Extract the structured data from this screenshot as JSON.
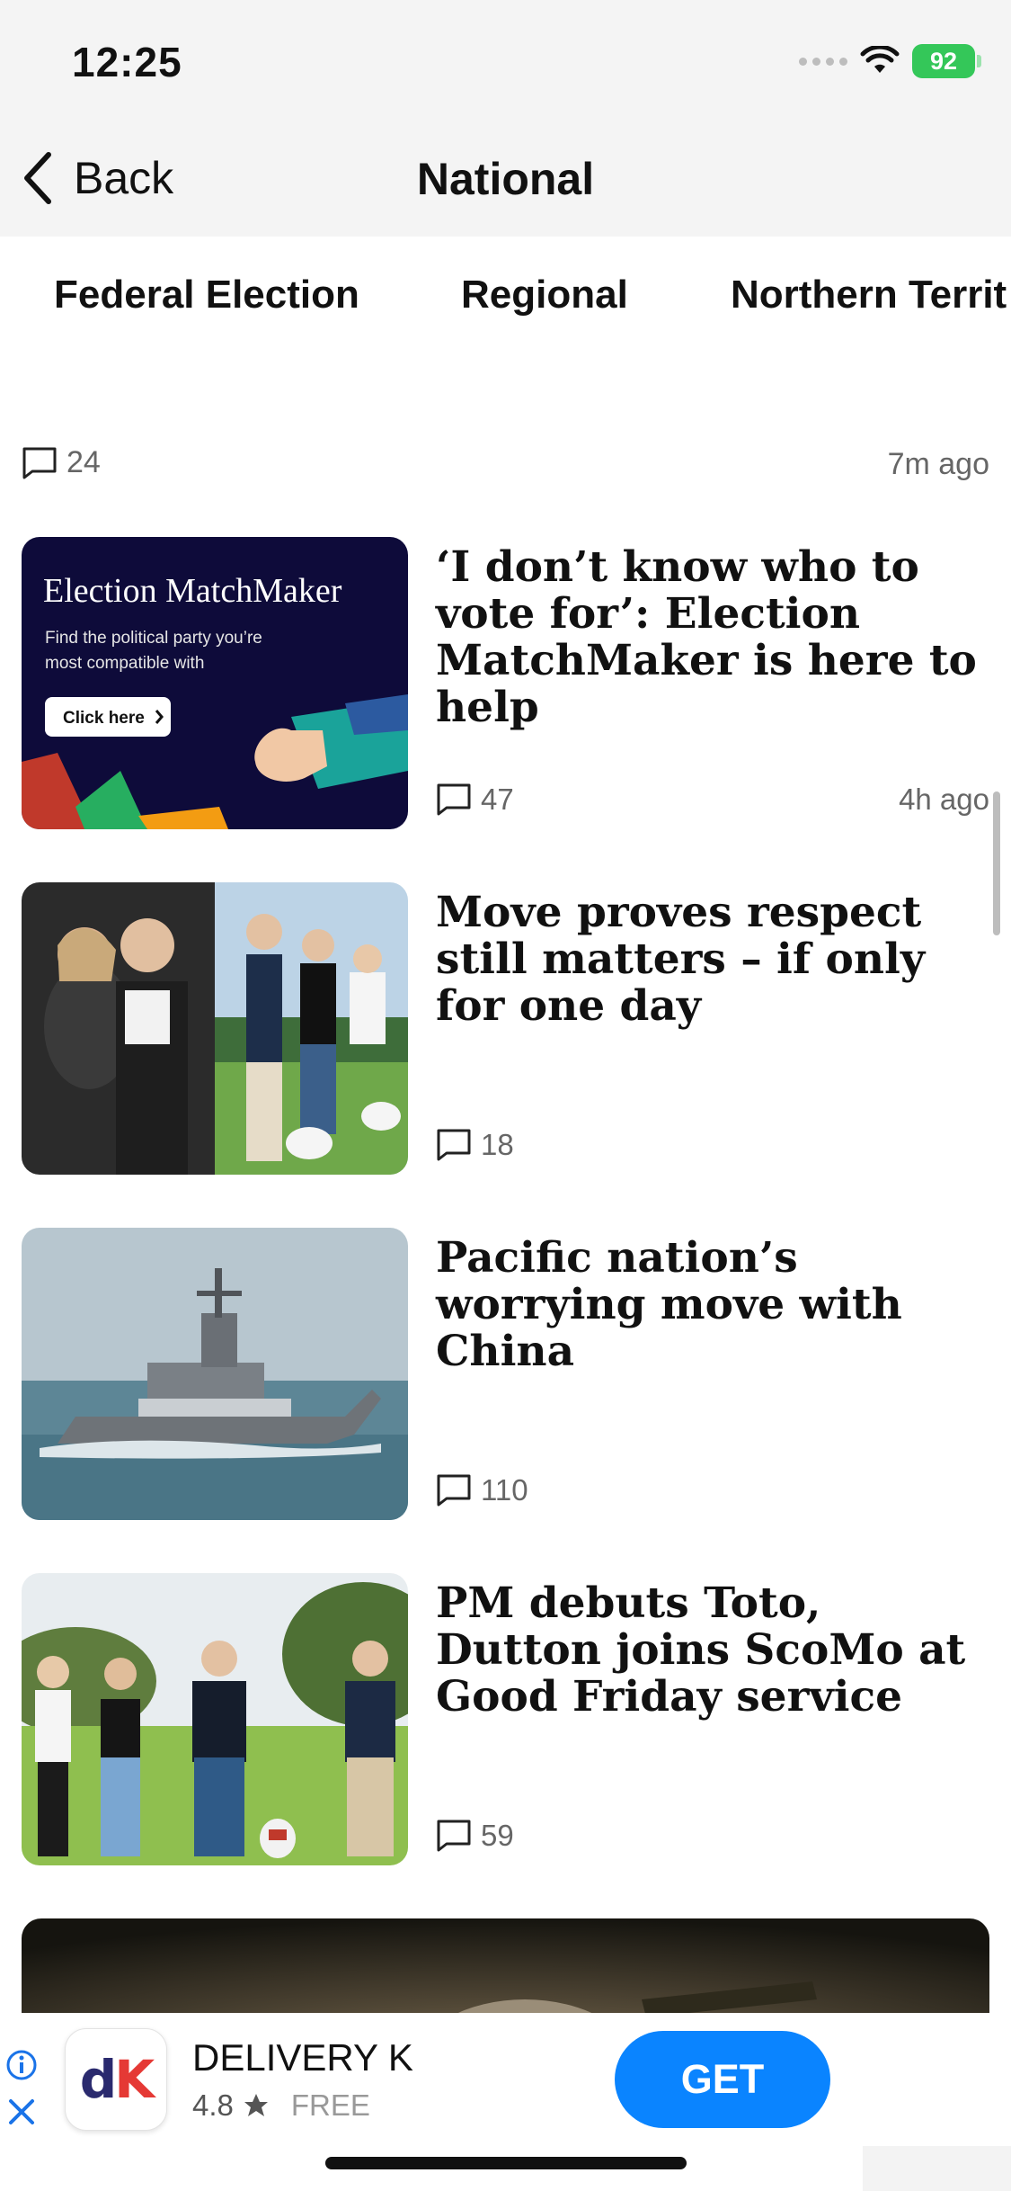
{
  "status_bar": {
    "time": "12:25",
    "battery": "92"
  },
  "nav": {
    "back_label": "Back",
    "title": "National"
  },
  "tabs": [
    {
      "label": "Federal Election"
    },
    {
      "label": "Regional"
    },
    {
      "label": "Northern Territ"
    }
  ],
  "top_meta": {
    "comments": "24",
    "time": "7m  ago"
  },
  "articles": [
    {
      "headline": "‘I don’t know who to vote for’: Election MatchMaker is here to help",
      "comments": "47",
      "time": "4h  ago",
      "thumb_text": {
        "title": "Election MatchMaker",
        "subtitle_1": "Find the political party you’re",
        "subtitle_2": "most compatible with",
        "button": "Click here"
      }
    },
    {
      "headline": "Move proves respect still matters – if only for one day",
      "comments": "18"
    },
    {
      "headline": "Pacific nation’s worrying move with China",
      "comments": "110"
    },
    {
      "headline": "PM debuts Toto, Dutton joins ScoMo at Good Friday service",
      "comments": "59"
    }
  ],
  "ad": {
    "logo_text": "dK",
    "app_name": "DELIVERY K",
    "rating": "4.8",
    "price": "FREE",
    "cta": "GET"
  },
  "colors": {
    "accent_blue": "#0a84ff",
    "battery_green": "#34c759",
    "ad_logo_navy": "#2a2a6e",
    "ad_logo_red": "#e53935"
  },
  "icons": [
    "chevron-left-icon",
    "wifi-icon",
    "battery-icon",
    "comment-icon",
    "star-icon",
    "info-icon",
    "close-icon"
  ]
}
